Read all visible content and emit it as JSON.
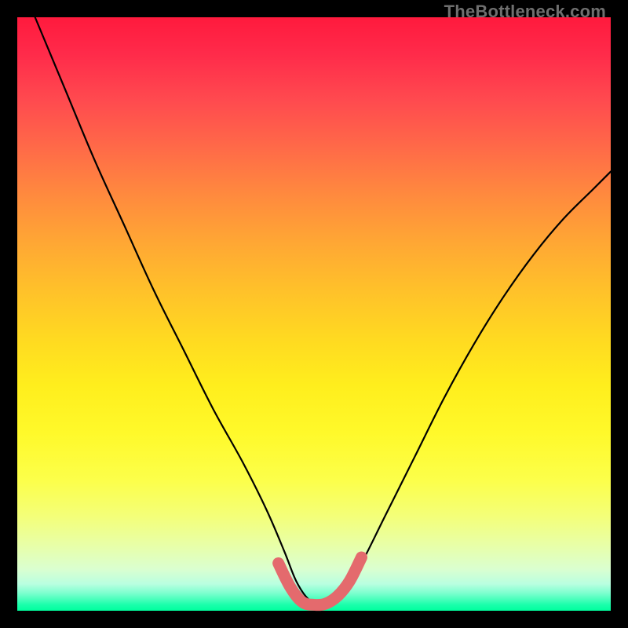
{
  "watermark": "TheBottleneck.com",
  "chart_data": {
    "type": "line",
    "title": "",
    "xlabel": "",
    "ylabel": "",
    "xlim": [
      0,
      100
    ],
    "ylim": [
      0,
      100
    ],
    "series": [
      {
        "name": "bottleneck-curve",
        "color": "#000000",
        "x": [
          3,
          8,
          13,
          18,
          23,
          28,
          33,
          38,
          42,
          45,
          47,
          49,
          51,
          53,
          55,
          58,
          62,
          67,
          72,
          77,
          82,
          87,
          92,
          97,
          100
        ],
        "y": [
          100,
          88,
          76,
          65,
          54,
          44,
          34,
          25,
          17,
          10,
          5,
          2,
          1,
          1,
          3,
          8,
          16,
          26,
          36,
          45,
          53,
          60,
          66,
          71,
          74
        ]
      },
      {
        "name": "optimal-zone-highlight",
        "color": "#e46a6d",
        "x": [
          44,
          46,
          48,
          50,
          52,
          54,
          56,
          58
        ],
        "y": [
          8,
          4,
          1.5,
          1,
          1.2,
          2.5,
          5,
          9
        ]
      }
    ]
  },
  "colors": {
    "frame": "#000000",
    "highlight": "#e46a6d",
    "curve": "#000000",
    "band_green": "#00ff9e",
    "band_red": "#ff1a3d"
  }
}
